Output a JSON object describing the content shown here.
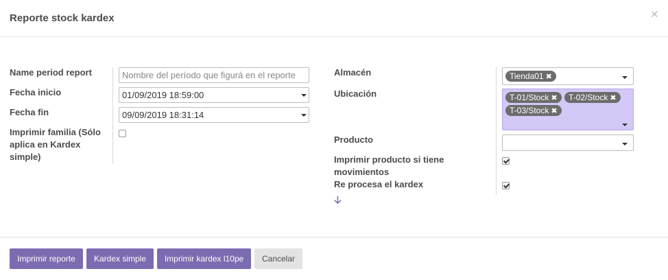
{
  "dialog": {
    "title": "Reporte stock kardex",
    "close_glyph": "×"
  },
  "left": {
    "name_period": {
      "label": "Name period report",
      "placeholder": "Nombre del período que figurá en el reporte"
    },
    "fecha_inicio": {
      "label": "Fecha inicio",
      "value": "01/09/2019 18:59:00"
    },
    "fecha_fin": {
      "label": "Fecha fin",
      "value": "09/09/2019 18:31:14"
    },
    "imprimir_familia": {
      "label_line1": "Imprimir familia (Sólo",
      "label_line2": "aplica en Kardex",
      "label_line3": "simple)",
      "checked": false
    }
  },
  "right": {
    "almacen": {
      "label": "Almacén",
      "tags": [
        "Tienda01"
      ]
    },
    "ubicacion": {
      "label": "Ubicación",
      "tags": [
        "T-01/Stock",
        "T-02/Stock",
        "T-03/Stock"
      ]
    },
    "producto": {
      "label": "Producto",
      "value": ""
    },
    "imprimir_producto": {
      "label_line1": "Imprimir producto si tiene",
      "label_line2": "movimientos",
      "checked": true
    },
    "reprocesa": {
      "label": "Re procesa el kardex",
      "checked": true
    }
  },
  "tag_remove_glyph": "✖",
  "arrow_glyph": "🡣",
  "footer": {
    "buttons": [
      "Imprimir reporte",
      "Kardex simple",
      "Imprimir kardex l10pe",
      "Cancelar"
    ]
  },
  "colors": {
    "primary": "#7c6bb0",
    "tag_bg": "#6c6c6c",
    "selection_bg": "#d4c8f7",
    "secondary_btn": "#e3e3e3"
  }
}
